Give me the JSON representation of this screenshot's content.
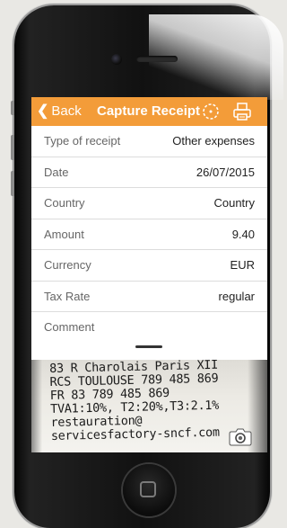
{
  "navbar": {
    "back_label": "Back",
    "title": "Capture Receipt",
    "icons": [
      "target-icon",
      "print-icon"
    ],
    "color": "#f39c39"
  },
  "form": {
    "rows": [
      {
        "label": "Type of receipt",
        "value": "Other expenses"
      },
      {
        "label": "Date",
        "value": "26/07/2015"
      },
      {
        "label": "Country",
        "value": "Country"
      },
      {
        "label": "Amount",
        "value": "9.40"
      },
      {
        "label": "Currency",
        "value": "EUR"
      },
      {
        "label": "Tax Rate",
        "value": "regular"
      },
      {
        "label": "Comment",
        "value": ""
      }
    ]
  },
  "receipt": {
    "lines": [
      "83 R Charolais Paris XII",
      "RCS TOULOUSE 789 485 869",
      "FR 83 789 485 869",
      "TVA1:10%, T2:20%,T3:2.1%",
      "restauration@",
      "servicesfactory-sncf.com"
    ]
  },
  "camera_icon": "camera-icon"
}
